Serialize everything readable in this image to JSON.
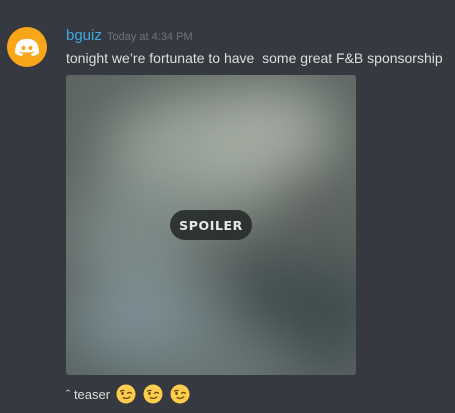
{
  "message": {
    "username": "bguiz",
    "timestamp": "Today at 4:34 PM",
    "text": "tonight we’re fortunate to have  some great F&B sponsorship",
    "attachment": {
      "spoiler_label": "SPOILER"
    },
    "followup": {
      "text": "ˆ teaser",
      "emojis": [
        "wink-face-icon",
        "wink-face-icon",
        "wink-face-icon"
      ]
    }
  },
  "colors": {
    "background": "#36393f",
    "username": "#3fa8e0",
    "avatar": "#faa61a",
    "text": "#dcddde",
    "timestamp": "#6e7379"
  }
}
